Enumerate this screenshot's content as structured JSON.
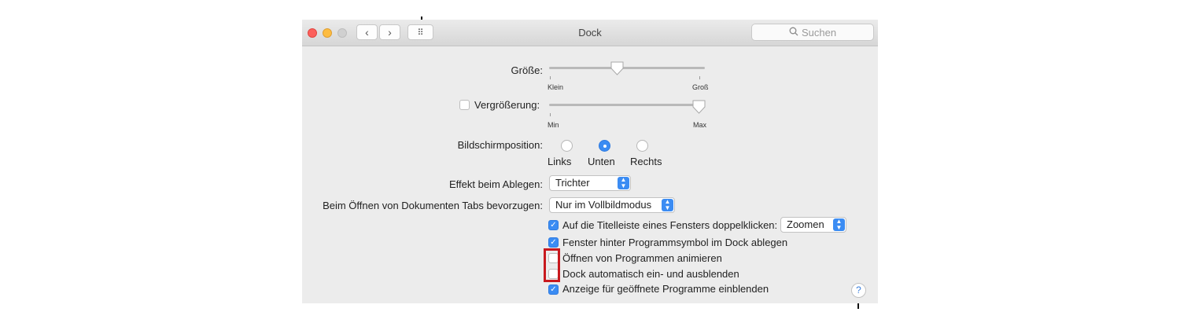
{
  "window": {
    "title": "Dock",
    "search_placeholder": "Suchen",
    "nav_back": "‹",
    "nav_forward": "›",
    "grid": "⠿"
  },
  "size": {
    "label": "Größe:",
    "min_label": "Klein",
    "max_label": "Groß",
    "value": 0.43
  },
  "magnification": {
    "label": "Vergrößerung:",
    "checked": false,
    "min_label": "Min",
    "max_label": "Max",
    "value": 0.96
  },
  "position": {
    "label": "Bildschirmposition:",
    "options": [
      "Links",
      "Unten",
      "Rechts"
    ],
    "selected": "Unten"
  },
  "minimize_effect": {
    "label": "Effekt beim Ablegen:",
    "value": "Trichter"
  },
  "prefer_tabs": {
    "label": "Beim Öffnen von Dokumenten Tabs bevorzugen:",
    "value": "Nur im Vollbildmodus"
  },
  "options": [
    {
      "text": "Auf die Titelleiste eines Fensters doppelklicken:",
      "checked": true,
      "popup": "Zoomen"
    },
    {
      "text": "Fenster hinter Programmsymbol im Dock ablegen",
      "checked": true
    },
    {
      "text": "Öffnen von Programmen animieren",
      "checked": false
    },
    {
      "text": "Dock automatisch ein- und ausblenden",
      "checked": false
    },
    {
      "text": "Anzeige für geöffnete Programme einblenden",
      "checked": true
    }
  ],
  "help": "?",
  "colors": {
    "accent": "#3b8cf3",
    "highlight_box": "#c8191e",
    "close": "#fc605c",
    "minimize": "#fdbc40"
  }
}
